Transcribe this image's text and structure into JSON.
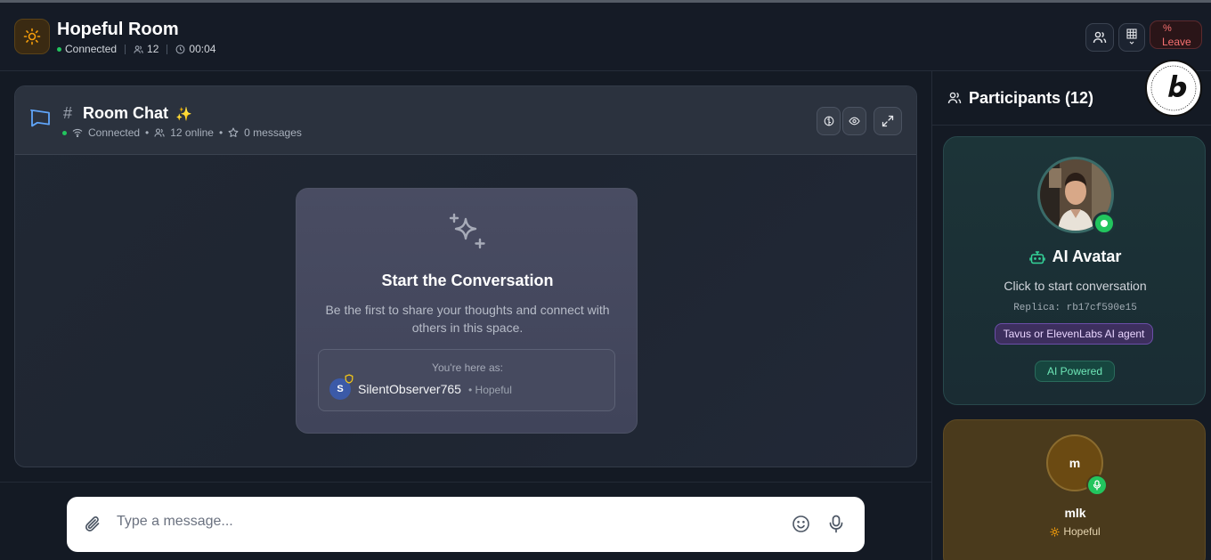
{
  "header": {
    "title": "Hopeful Room",
    "status": "Connected",
    "participant_count": "12",
    "timer": "00:04",
    "leave_label": "Leave",
    "leave_glyph": "%"
  },
  "chat": {
    "hash": "#",
    "title": "Room Chat",
    "status": "Connected",
    "online": "12 online",
    "messages": "0 messages",
    "empty_title": "Start the Conversation",
    "empty_subtitle": "Be the first to share your thoughts and connect with others in this space.",
    "here_as_label": "You're here as:",
    "user_initial": "S",
    "user_name": "SilentObserver765",
    "user_mood": "• Hopeful"
  },
  "composer": {
    "placeholder": "Type a message..."
  },
  "sidebar": {
    "title": "Participants (12)",
    "ai": {
      "name": "AI Avatar",
      "subtitle": "Click to start conversation",
      "replica": "Replica: rb17cf590e15",
      "tag": "Tavus or ElevenLabs AI agent",
      "powered": "AI Powered"
    },
    "user": {
      "initial": "m",
      "name": "mlk",
      "mood": "Hopeful"
    }
  },
  "colors": {
    "accent_green": "#22c55e",
    "room_icon": "#f59e0b",
    "leave": "#f87171",
    "sparkle": "#facc15"
  }
}
